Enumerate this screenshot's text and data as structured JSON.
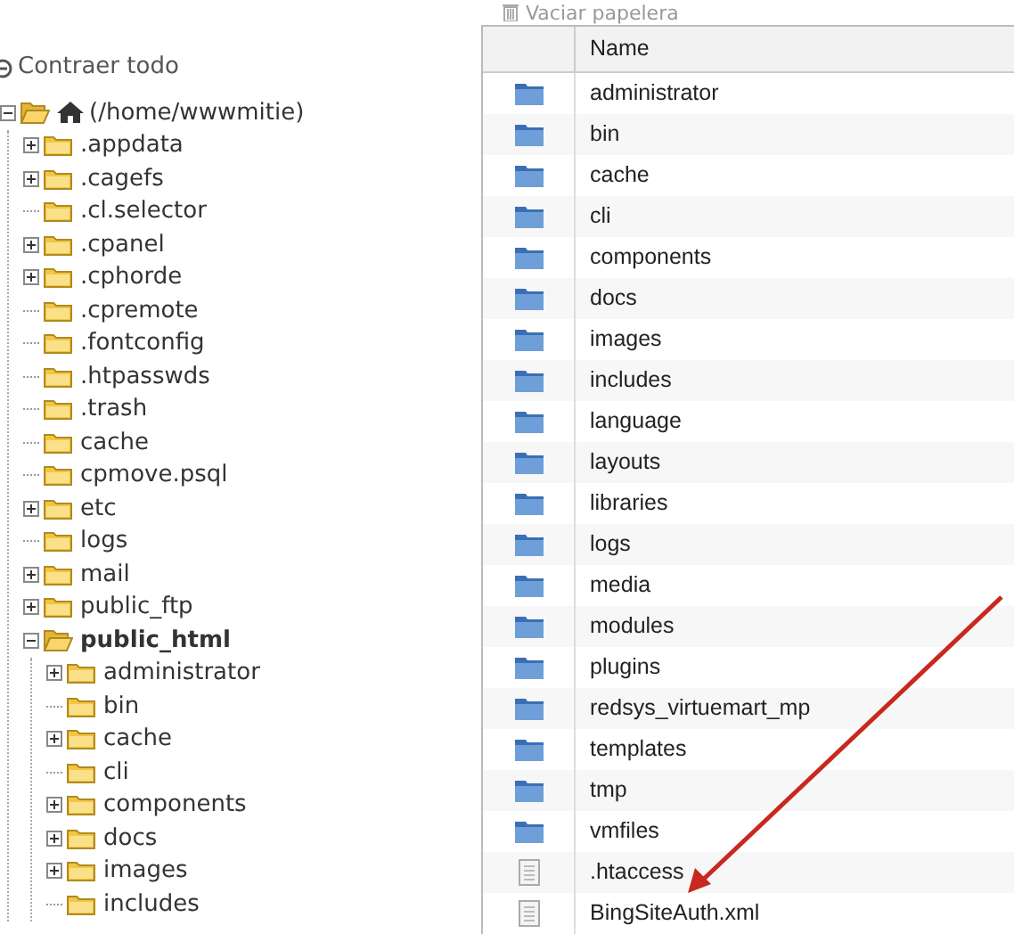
{
  "toolbar": {
    "empty_trash": "Vaciar papelera"
  },
  "collapse_all": "Contraer todo",
  "tree": {
    "label": "(/home/wwwmitie)",
    "expandable": true,
    "expanded": true,
    "selected": false,
    "children": [
      {
        "label": ".appdata",
        "expandable": true,
        "expanded": false,
        "selected": false
      },
      {
        "label": ".cagefs",
        "expandable": true,
        "expanded": false,
        "selected": false
      },
      {
        "label": ".cl.selector",
        "expandable": false,
        "expanded": false,
        "selected": false
      },
      {
        "label": ".cpanel",
        "expandable": true,
        "expanded": false,
        "selected": false
      },
      {
        "label": ".cphorde",
        "expandable": true,
        "expanded": false,
        "selected": false
      },
      {
        "label": ".cpremote",
        "expandable": false,
        "expanded": false,
        "selected": false
      },
      {
        "label": ".fontconfig",
        "expandable": false,
        "expanded": false,
        "selected": false
      },
      {
        "label": ".htpasswds",
        "expandable": false,
        "expanded": false,
        "selected": false
      },
      {
        "label": ".trash",
        "expandable": false,
        "expanded": false,
        "selected": false
      },
      {
        "label": "cache",
        "expandable": false,
        "expanded": false,
        "selected": false
      },
      {
        "label": "cpmove.psql",
        "expandable": false,
        "expanded": false,
        "selected": false
      },
      {
        "label": "etc",
        "expandable": true,
        "expanded": false,
        "selected": false
      },
      {
        "label": "logs",
        "expandable": false,
        "expanded": false,
        "selected": false
      },
      {
        "label": "mail",
        "expandable": true,
        "expanded": false,
        "selected": false
      },
      {
        "label": "public_ftp",
        "expandable": true,
        "expanded": false,
        "selected": false
      },
      {
        "label": "public_html",
        "expandable": true,
        "expanded": true,
        "selected": true,
        "children": [
          {
            "label": "administrator",
            "expandable": true,
            "expanded": false,
            "selected": false
          },
          {
            "label": "bin",
            "expandable": false,
            "expanded": false,
            "selected": false
          },
          {
            "label": "cache",
            "expandable": true,
            "expanded": false,
            "selected": false
          },
          {
            "label": "cli",
            "expandable": false,
            "expanded": false,
            "selected": false
          },
          {
            "label": "components",
            "expandable": true,
            "expanded": false,
            "selected": false
          },
          {
            "label": "docs",
            "expandable": true,
            "expanded": false,
            "selected": false
          },
          {
            "label": "images",
            "expandable": true,
            "expanded": false,
            "selected": false
          },
          {
            "label": "includes",
            "expandable": false,
            "expanded": false,
            "selected": false
          }
        ]
      }
    ]
  },
  "table": {
    "columns": [
      "Name"
    ],
    "rows": [
      {
        "kind": "folder",
        "name": "administrator"
      },
      {
        "kind": "folder",
        "name": "bin"
      },
      {
        "kind": "folder",
        "name": "cache"
      },
      {
        "kind": "folder",
        "name": "cli"
      },
      {
        "kind": "folder",
        "name": "components"
      },
      {
        "kind": "folder",
        "name": "docs"
      },
      {
        "kind": "folder",
        "name": "images"
      },
      {
        "kind": "folder",
        "name": "includes"
      },
      {
        "kind": "folder",
        "name": "language"
      },
      {
        "kind": "folder",
        "name": "layouts"
      },
      {
        "kind": "folder",
        "name": "libraries"
      },
      {
        "kind": "folder",
        "name": "logs"
      },
      {
        "kind": "folder",
        "name": "media"
      },
      {
        "kind": "folder",
        "name": "modules"
      },
      {
        "kind": "folder",
        "name": "plugins"
      },
      {
        "kind": "folder",
        "name": "redsys_virtuemart_mp"
      },
      {
        "kind": "folder",
        "name": "templates"
      },
      {
        "kind": "folder",
        "name": "tmp"
      },
      {
        "kind": "folder",
        "name": "vmfiles"
      },
      {
        "kind": "file",
        "name": ".htaccess"
      },
      {
        "kind": "file",
        "name": "BingSiteAuth.xml"
      }
    ]
  }
}
